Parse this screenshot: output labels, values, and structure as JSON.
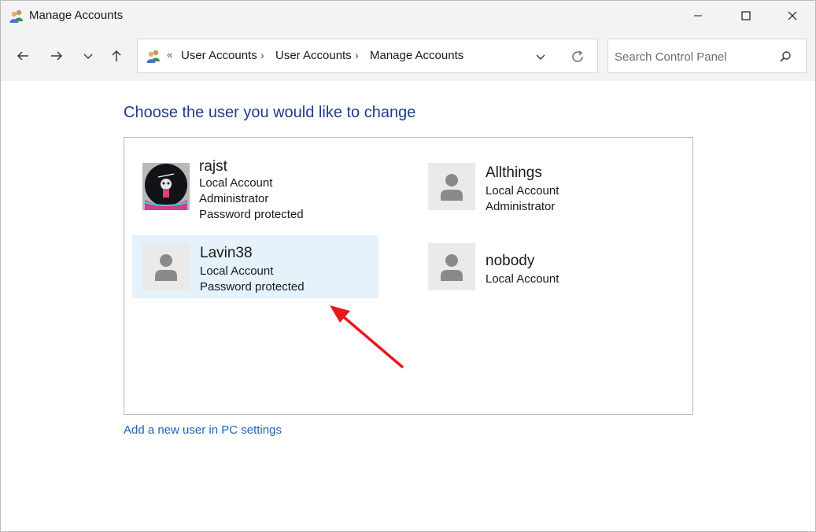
{
  "window": {
    "title": "Manage Accounts"
  },
  "icons": {
    "app": "users-icon",
    "back": "arrow-left-icon",
    "forward": "arrow-right-icon",
    "recent": "chevron-down-icon",
    "up": "arrow-up-icon",
    "refresh": "refresh-icon",
    "search": "search-icon"
  },
  "address_bar": {
    "overflow": "«",
    "crumbs": [
      "User Accounts",
      "User Accounts",
      "Manage Accounts"
    ],
    "separator": "›"
  },
  "search": {
    "placeholder": "Search Control Panel"
  },
  "main": {
    "heading": "Choose the user you would like to change",
    "accounts": [
      {
        "name": "rajst",
        "lines": [
          "Local Account",
          "Administrator",
          "Password protected"
        ],
        "avatar": "custom-photo",
        "selected": false
      },
      {
        "name": "Allthings",
        "lines": [
          "Local Account",
          "Administrator"
        ],
        "avatar": "default-user-icon",
        "selected": false
      },
      {
        "name": "Lavin38",
        "lines": [
          "Local Account",
          "Password protected"
        ],
        "avatar": "default-user-icon",
        "selected": true
      },
      {
        "name": "nobody",
        "lines": [
          "Local Account"
        ],
        "avatar": "default-user-icon",
        "selected": false
      }
    ],
    "add_user_link": "Add a new user in PC settings"
  },
  "colors": {
    "heading": "#1e3c8c",
    "link": "#1e64b4",
    "selected_bg": "#e5f1fb",
    "annotation_arrow": "#e8191e"
  }
}
